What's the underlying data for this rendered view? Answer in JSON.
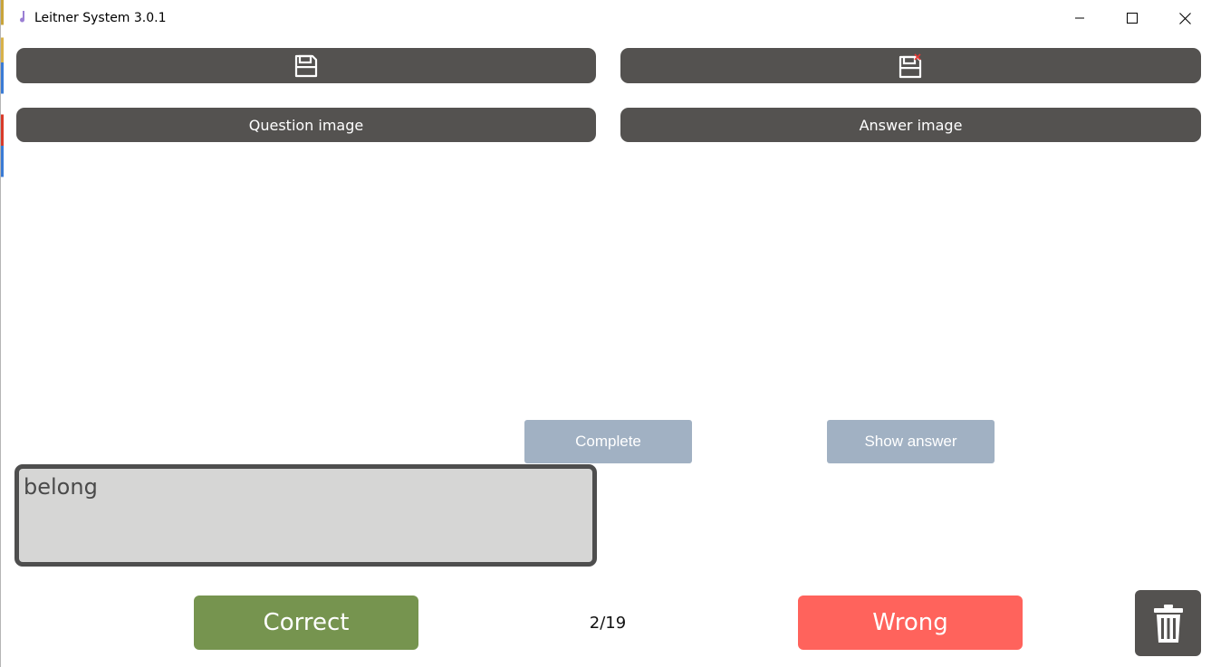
{
  "window": {
    "title": "Leitner System 3.0.1",
    "app_icon": "music-note-icon",
    "controls": [
      "minimize-icon",
      "maximize-icon",
      "close-icon"
    ]
  },
  "toolbar": {
    "save_question_icon": "save-icon",
    "save_answer_icon": "save-delete-icon",
    "question_image_label": "Question image",
    "answer_image_label": "Answer image"
  },
  "actions": {
    "complete_label": "Complete",
    "show_answer_label": "Show answer"
  },
  "answer_box": {
    "value": "belong"
  },
  "footer": {
    "correct_label": "Correct",
    "wrong_label": "Wrong",
    "counter": "2/19",
    "trash_icon": "trash-icon"
  },
  "colors": {
    "dark_button": "#545250",
    "light_button": "#a1b1c3",
    "correct": "#76944f",
    "wrong": "#ff635c",
    "answer_bg": "#d6d6d5"
  }
}
